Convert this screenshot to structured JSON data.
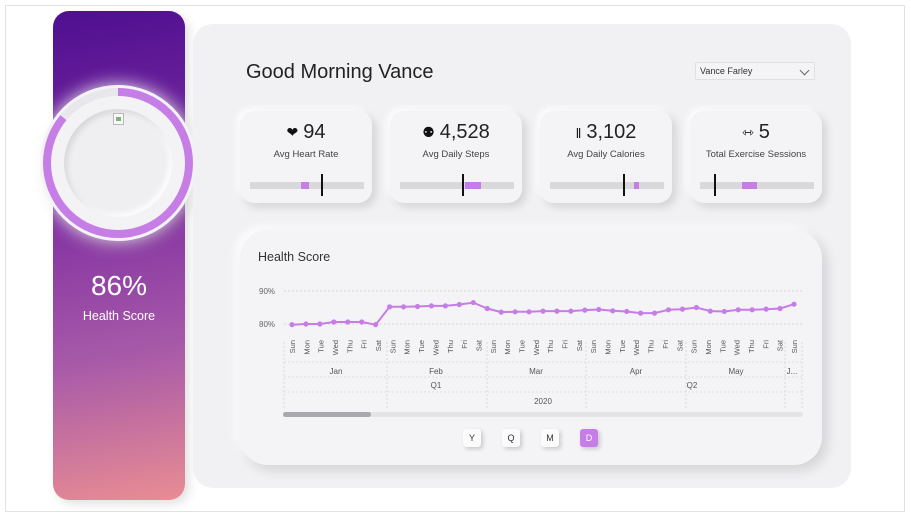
{
  "sidebar": {
    "health_score": "86%",
    "health_score_label": "Health Score",
    "ring_progress": 0.86,
    "image_icon": "broken-image-icon"
  },
  "header": {
    "greeting": "Good Morning Vance",
    "user_select": "Vance Farley"
  },
  "kpis": [
    {
      "icon": "heart-icon",
      "glyph": "❤",
      "value": "94",
      "label": "Avg Heart Rate",
      "range": [
        0.45,
        0.52
      ],
      "marker": 0.62
    },
    {
      "icon": "footsteps-icon",
      "glyph": "⚉",
      "value": "4,528",
      "label": "Avg Daily Steps",
      "range": [
        0.57,
        0.71
      ],
      "marker": 0.54
    },
    {
      "icon": "cutlery-icon",
      "glyph": "‖",
      "value": "3,102",
      "label": "Avg Daily Calories",
      "range": [
        0.74,
        0.78
      ],
      "marker": 0.64
    },
    {
      "icon": "dumbbell-icon",
      "glyph": "⇿",
      "value": "5",
      "label": "Total Exercise Sessions",
      "range": [
        0.37,
        0.5
      ],
      "marker": 0.12
    }
  ],
  "chart": {
    "title": "Health Score",
    "buttons": [
      "Y",
      "Q",
      "M",
      "D"
    ],
    "active_button": "D",
    "accent": "#c77de6"
  },
  "chart_data": {
    "type": "line",
    "title": "Health Score",
    "yticks": [
      "90%",
      "80%"
    ],
    "ylim": [
      0.77,
      0.92
    ],
    "grid": true,
    "x": [
      "Sun",
      "Mon",
      "Tue",
      "Wed",
      "Thu",
      "Fri",
      "Sat",
      "Sun",
      "Mon",
      "Tue",
      "Wed",
      "Thu",
      "Fri",
      "Sat",
      "Sun",
      "Mon",
      "Tue",
      "Wed",
      "Thu",
      "Fri",
      "Sat",
      "Sun",
      "Mon",
      "Tue",
      "Wed",
      "Thu",
      "Fri",
      "Sat",
      "Sun",
      "Mon",
      "Tue",
      "Wed",
      "Thu",
      "Fri",
      "Sat",
      "Sun"
    ],
    "values": [
      0.798,
      0.8,
      0.8,
      0.806,
      0.806,
      0.806,
      0.798,
      0.852,
      0.852,
      0.853,
      0.855,
      0.855,
      0.859,
      0.865,
      0.847,
      0.836,
      0.837,
      0.837,
      0.839,
      0.839,
      0.839,
      0.842,
      0.844,
      0.84,
      0.838,
      0.833,
      0.833,
      0.843,
      0.845,
      0.85,
      0.839,
      0.838,
      0.843,
      0.843,
      0.845,
      0.847,
      0.86
    ],
    "months": [
      "Jan",
      "Feb",
      "Mar",
      "Apr",
      "May",
      "J..."
    ],
    "quarters": [
      "Q1",
      "Q2"
    ],
    "year": "2020"
  }
}
